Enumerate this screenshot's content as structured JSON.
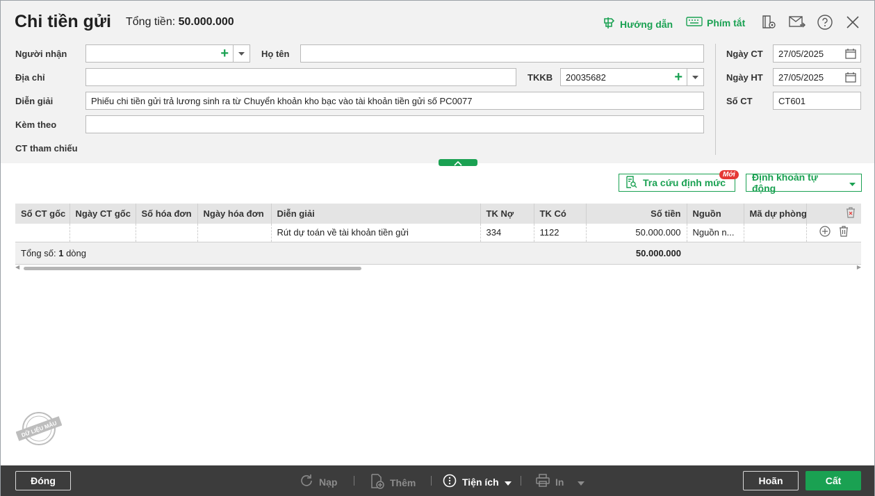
{
  "header": {
    "title": "Chi tiền gửi",
    "total_label": "Tổng tiền:",
    "total_value": "50.000.000",
    "guide_label": "Hướng dẫn",
    "shortcut_label": "Phím tắt"
  },
  "form": {
    "recipient_label": "Người nhận",
    "recipient_value": "",
    "name_label": "Họ tên",
    "name_value": "",
    "address_label": "Địa chỉ",
    "address_value": "",
    "tkkb_label": "TKKB",
    "tkkb_value": "20035682",
    "description_label": "Diễn giải",
    "description_value": "Phiếu chi tiền gửi trả lương sinh ra từ Chuyển khoản kho bạc vào tài khoản tiền gửi số PC0077",
    "attach_label": "Kèm theo",
    "attach_value": "",
    "reference_label": "CT tham chiếu",
    "doc_date_label": "Ngày CT",
    "doc_date_value": "27/05/2025",
    "post_date_label": "Ngày HT",
    "post_date_value": "27/05/2025",
    "doc_no_label": "Số CT",
    "doc_no_value": "CT601"
  },
  "toolbar": {
    "lookup_label": "Tra cứu định mức",
    "new_badge": "Mới",
    "auto_entry_label": "Định khoản tự động"
  },
  "grid": {
    "columns": [
      "Số CT gốc",
      "Ngày CT gốc",
      "Số hóa đơn",
      "Ngày hóa đơn",
      "Diễn giải",
      "TK Nợ",
      "TK Có",
      "Số tiền",
      "Nguồn",
      "Mã dự phòng"
    ],
    "rows": [
      {
        "so_ct_goc": "",
        "ngay_ct_goc": "",
        "so_hoa_don": "",
        "ngay_hoa_don": "",
        "dien_giai": "Rút dự toán về tài khoản tiền gửi",
        "tk_no": "334",
        "tk_co": "1122",
        "so_tien": "50.000.000",
        "nguon": "Nguồn n...",
        "ma_du_phong": ""
      }
    ],
    "footer_prefix": "Tổng số:",
    "footer_count": "1",
    "footer_suffix": "dòng",
    "footer_total": "50.000.000"
  },
  "stamp_text": "DỮ LIỆU MẪU",
  "footer": {
    "close_label": "Đóng",
    "reload_label": "Nạp",
    "add_label": "Thêm",
    "utility_label": "Tiện ích",
    "print_label": "In",
    "undo_label": "Hoãn",
    "save_label": "Cất"
  },
  "colors": {
    "accent": "#1aa152",
    "footer_bg": "#3c3c3c",
    "badge": "#e53935"
  },
  "icons": [
    "guide-icon",
    "keyboard-icon",
    "view-icon",
    "email-icon",
    "help-icon",
    "close-icon",
    "plus-icon",
    "chevron-down-icon",
    "calendar-icon",
    "chevron-up-icon",
    "lookup-icon",
    "delete-icon",
    "add-row-icon",
    "reload-icon",
    "add-doc-icon",
    "info-icon",
    "print-icon"
  ]
}
